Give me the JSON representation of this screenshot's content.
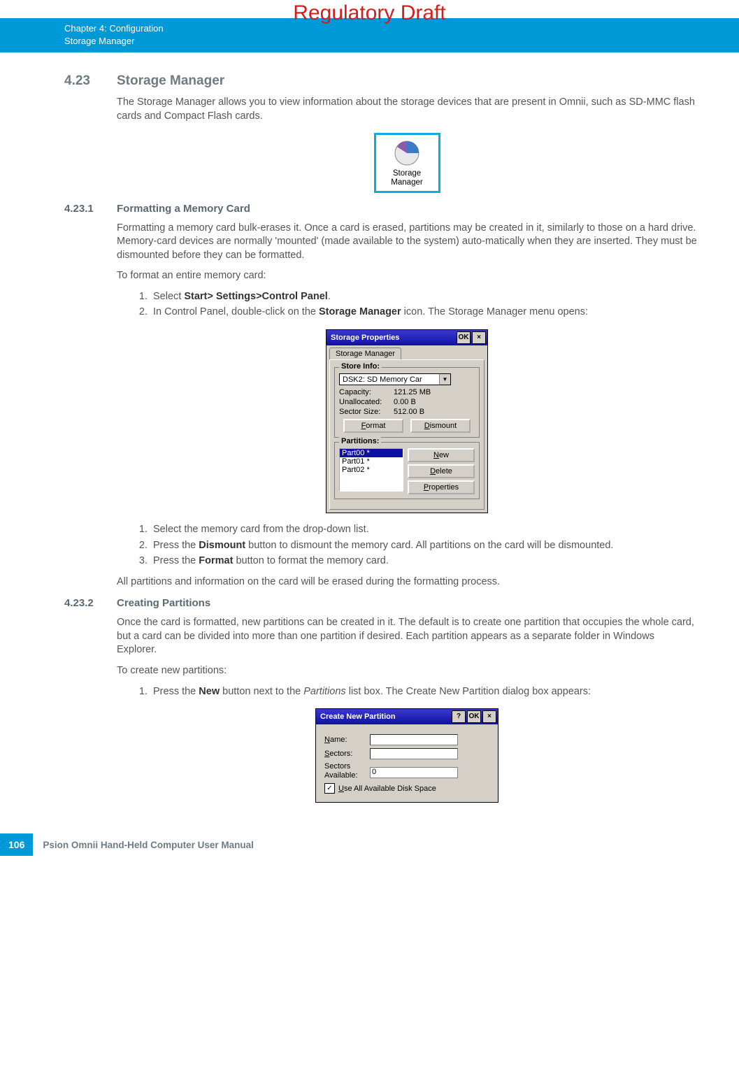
{
  "watermark": "Regulatory Draft",
  "header": {
    "chapter": "Chapter 4:  Configuration",
    "section": "Storage Manager"
  },
  "sec423": {
    "num": "4.23",
    "title": "Storage Manager",
    "intro": "The Storage Manager allows you to view information about the storage devices that are present in Omnii, such as SD-MMC flash cards and Compact Flash cards.",
    "icon_label1": "Storage",
    "icon_label2": "Manager"
  },
  "sec4231": {
    "num": "4.23.1",
    "title": "Formatting a Memory Card",
    "p1": "Formatting a memory card bulk-erases it. Once a card is erased, partitions may be created in it, similarly to those on a hard drive. Memory-card devices are normally 'mounted' (made available to the system) auto-matically when they are inserted. They must be dismounted before they can be formatted.",
    "p2": "To format an entire memory card:",
    "step1_pre": "Select ",
    "step1_bold": "Start> Settings>Control Panel",
    "step1_post": ".",
    "step2_pre": "In Control Panel, double-click on the ",
    "step2_bold": "Storage Manager",
    "step2_post": " icon. The Storage Manager menu opens:",
    "after_steps": {
      "s1": "Select the memory card from the drop-down list.",
      "s2_pre": "Press the ",
      "s2_bold": "Dismount",
      "s2_post": " button to dismount the memory card. All partitions on the card will be dismounted.",
      "s3_pre": "Press the ",
      "s3_bold": "Format",
      "s3_post": " button to format the memory card."
    },
    "p3": "All partitions and information on the card will be erased during the formatting process."
  },
  "dialog_sp": {
    "title": "Storage Properties",
    "ok": "OK",
    "tab": "Storage Manager",
    "group_store": "Store Info:",
    "dropdown": "DSK2: SD Memory Car",
    "capacity_l": "Capacity:",
    "capacity_v": "121.25 MB",
    "unalloc_l": "Unallocated:",
    "unalloc_v": "0.00 B",
    "sector_l": "Sector Size:",
    "sector_v": "512.00 B",
    "format_btn": "ormat",
    "format_u": "F",
    "dismount_btn": "ismount",
    "dismount_u": "D",
    "group_parts": "Partitions:",
    "parts": [
      "Part00 *",
      "Part01 *",
      "Part02 *"
    ],
    "new_btn": "ew",
    "new_u": "N",
    "delete_btn": "elete",
    "delete_u": "D",
    "props_btn": "roperties",
    "props_u": "P"
  },
  "sec4232": {
    "num": "4.23.2",
    "title": "Creating Partitions",
    "p1": "Once the card is formatted, new partitions can be created in it. The default is to create one partition that occupies the whole card, but a card can be divided into more than one partition if desired. Each partition appears as a separate folder in Windows Explorer.",
    "p2": "To create new partitions:",
    "step1_pre": "Press the ",
    "step1_bold": "New",
    "step1_mid": " button next to the ",
    "step1_italic": "Partitions",
    "step1_post": " list box. The Create New Partition dialog box appears:"
  },
  "dialog_cnp": {
    "title": "Create New Partition",
    "help": "?",
    "ok": "OK",
    "name_l": "ame:",
    "name_u": "N",
    "sectors_l": "ectors:",
    "sectors_u": "S",
    "avail_l1": "Sectors",
    "avail_l2": "Available:",
    "avail_v": "0",
    "check_u": "U",
    "check_l": "se All Available Disk Space"
  },
  "footer": {
    "page": "106",
    "text": "Psion Omnii Hand-Held Computer User Manual"
  }
}
